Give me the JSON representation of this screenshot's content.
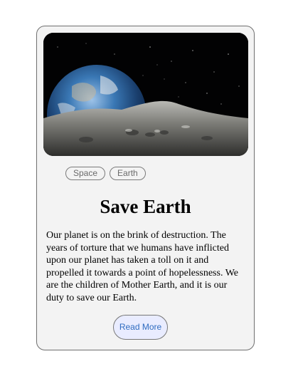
{
  "card": {
    "image_alt": "Earth rising over the lunar surface",
    "tags": [
      "Space",
      "Earth"
    ],
    "title": "Save Earth",
    "description": "Our planet is on the brink of destruction. The years of torture that we humans have inflicted upon our planet has taken a toll on it and propelled it towards a point of hopelessness. We are the children of Mother Earth, and it is our duty to save our Earth.",
    "button_label": "Read More"
  },
  "colors": {
    "card_background": "#f3f3f3",
    "button_background": "#e9ecff",
    "button_text": "#2f6cc0"
  }
}
